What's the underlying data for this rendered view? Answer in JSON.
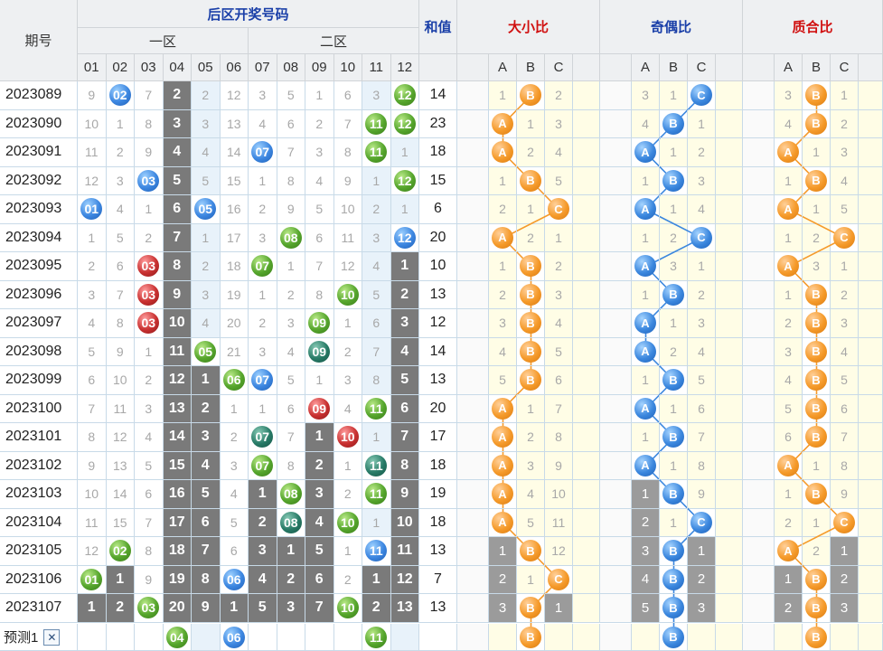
{
  "header": {
    "period_label": "期号",
    "back_zone_title": "后区开奖号码",
    "zone1_label": "一区",
    "zone2_label": "二区",
    "sum_label": "和值",
    "ratio_titles": [
      "大小比",
      "奇偶比",
      "质合比"
    ],
    "numbers": [
      "01",
      "02",
      "03",
      "04",
      "05",
      "06",
      "07",
      "08",
      "09",
      "10",
      "11",
      "12"
    ],
    "abc": [
      "A",
      "B",
      "C"
    ]
  },
  "rows": [
    {
      "period": "2023089",
      "cells": [
        "9",
        {
          "b": "02",
          "c": "blue"
        },
        "7",
        {
          "d": "2"
        },
        "2",
        "12",
        "3",
        "5",
        "1",
        "6",
        "3",
        {
          "b": "12",
          "c": "green"
        }
      ],
      "sum": "14",
      "r1": [
        "1",
        {
          "o": "B"
        },
        "2"
      ],
      "r2": [
        "3",
        "1",
        {
          "u": "C"
        }
      ],
      "r3": [
        "3",
        {
          "o": "B"
        },
        "1"
      ]
    },
    {
      "period": "2023090",
      "cells": [
        "10",
        "1",
        "8",
        {
          "d": "3"
        },
        "3",
        "13",
        "4",
        "6",
        "2",
        "7",
        {
          "b": "11",
          "c": "green"
        },
        {
          "b": "12",
          "c": "green"
        }
      ],
      "sum": "23",
      "r1": [
        {
          "o": "A"
        },
        "1",
        "3"
      ],
      "r2": [
        "4",
        {
          "u": "B"
        },
        "1"
      ],
      "r3": [
        "4",
        {
          "o": "B"
        },
        "2"
      ]
    },
    {
      "period": "2023091",
      "cells": [
        "11",
        "2",
        "9",
        {
          "d": "4"
        },
        "4",
        "14",
        {
          "b": "07",
          "c": "blue"
        },
        "7",
        "3",
        "8",
        {
          "b": "11",
          "c": "green"
        },
        "1"
      ],
      "sum": "18",
      "r1": [
        {
          "o": "A"
        },
        "2",
        "4"
      ],
      "r2": [
        {
          "u": "A"
        },
        "1",
        "2"
      ],
      "r3": [
        {
          "o": "A"
        },
        "1",
        "3"
      ]
    },
    {
      "period": "2023092",
      "cells": [
        "12",
        "3",
        {
          "b": "03",
          "c": "blue"
        },
        {
          "d": "5"
        },
        "5",
        "15",
        "1",
        "8",
        "4",
        "9",
        "1",
        {
          "b": "12",
          "c": "green"
        }
      ],
      "sum": "15",
      "r1": [
        "1",
        {
          "o": "B"
        },
        "5"
      ],
      "r2": [
        "1",
        {
          "u": "B"
        },
        "3"
      ],
      "r3": [
        "1",
        {
          "o": "B"
        },
        "4"
      ]
    },
    {
      "period": "2023093",
      "cells": [
        {
          "b": "01",
          "c": "blue"
        },
        "4",
        "1",
        {
          "d": "6"
        },
        {
          "b": "05",
          "c": "blue"
        },
        "16",
        "2",
        "9",
        "5",
        "10",
        "2",
        "1"
      ],
      "sum": "6",
      "r1": [
        "2",
        "1",
        {
          "o": "C"
        }
      ],
      "r2": [
        {
          "u": "A"
        },
        "1",
        "4"
      ],
      "r3": [
        {
          "o": "A"
        },
        "1",
        "5"
      ]
    },
    {
      "period": "2023094",
      "cells": [
        "1",
        "5",
        "2",
        {
          "d": "7"
        },
        "1",
        "17",
        "3",
        {
          "b": "08",
          "c": "green"
        },
        "6",
        "11",
        "3",
        {
          "b": "12",
          "c": "blue"
        }
      ],
      "sum": "20",
      "r1": [
        {
          "o": "A"
        },
        "2",
        "1"
      ],
      "r2": [
        "1",
        "2",
        {
          "u": "C"
        }
      ],
      "r3": [
        "1",
        "2",
        {
          "o": "C"
        }
      ]
    },
    {
      "period": "2023095",
      "cells": [
        "2",
        "6",
        {
          "b": "03",
          "c": "red"
        },
        {
          "d": "8"
        },
        "2",
        "18",
        {
          "b": "07",
          "c": "green"
        },
        "1",
        "7",
        "12",
        "4",
        {
          "d": "1"
        }
      ],
      "sum": "10",
      "r1": [
        "1",
        {
          "o": "B"
        },
        "2"
      ],
      "r2": [
        {
          "u": "A"
        },
        "3",
        "1"
      ],
      "r3": [
        {
          "o": "A"
        },
        "3",
        "1"
      ]
    },
    {
      "period": "2023096",
      "cells": [
        "3",
        "7",
        {
          "b": "03",
          "c": "red"
        },
        {
          "d": "9"
        },
        "3",
        "19",
        "1",
        "2",
        "8",
        {
          "b": "10",
          "c": "green"
        },
        "5",
        {
          "d": "2"
        }
      ],
      "sum": "13",
      "r1": [
        "2",
        {
          "o": "B"
        },
        "3"
      ],
      "r2": [
        "1",
        {
          "u": "B"
        },
        "2"
      ],
      "r3": [
        "1",
        {
          "o": "B"
        },
        "2"
      ]
    },
    {
      "period": "2023097",
      "cells": [
        "4",
        "8",
        {
          "b": "03",
          "c": "red"
        },
        {
          "d": "10"
        },
        "4",
        "20",
        "2",
        "3",
        {
          "b": "09",
          "c": "green"
        },
        "1",
        "6",
        {
          "d": "3"
        }
      ],
      "sum": "12",
      "r1": [
        "3",
        {
          "o": "B"
        },
        "4"
      ],
      "r2": [
        {
          "u": "A"
        },
        "1",
        "3"
      ],
      "r3": [
        "2",
        {
          "o": "B"
        },
        "3"
      ]
    },
    {
      "period": "2023098",
      "cells": [
        "5",
        "9",
        "1",
        {
          "d": "11"
        },
        {
          "b": "05",
          "c": "green"
        },
        "21",
        "3",
        "4",
        {
          "b": "09",
          "c": "teal"
        },
        "2",
        "7",
        {
          "d": "4"
        }
      ],
      "sum": "14",
      "r1": [
        "4",
        {
          "o": "B"
        },
        "5"
      ],
      "r2": [
        {
          "u": "A"
        },
        "2",
        "4"
      ],
      "r3": [
        "3",
        {
          "o": "B"
        },
        "4"
      ]
    },
    {
      "period": "2023099",
      "cells": [
        "6",
        "10",
        "2",
        {
          "d": "12"
        },
        {
          "d": "1"
        },
        {
          "b": "06",
          "c": "green"
        },
        {
          "b": "07",
          "c": "blue"
        },
        "5",
        "1",
        "3",
        "8",
        {
          "d": "5"
        }
      ],
      "sum": "13",
      "r1": [
        "5",
        {
          "o": "B"
        },
        "6"
      ],
      "r2": [
        "1",
        {
          "u": "B"
        },
        "5"
      ],
      "r3": [
        "4",
        {
          "o": "B"
        },
        "5"
      ]
    },
    {
      "period": "2023100",
      "cells": [
        "7",
        "11",
        "3",
        {
          "d": "13"
        },
        {
          "d": "2"
        },
        "1",
        "1",
        "6",
        {
          "b": "09",
          "c": "red"
        },
        "4",
        {
          "b": "11",
          "c": "green"
        },
        {
          "d": "6"
        }
      ],
      "sum": "20",
      "r1": [
        {
          "o": "A"
        },
        "1",
        "7"
      ],
      "r2": [
        {
          "u": "A"
        },
        "1",
        "6"
      ],
      "r3": [
        "5",
        {
          "o": "B"
        },
        "6"
      ]
    },
    {
      "period": "2023101",
      "cells": [
        "8",
        "12",
        "4",
        {
          "d": "14"
        },
        {
          "d": "3"
        },
        "2",
        {
          "b": "07",
          "c": "teal"
        },
        "7",
        {
          "d": "1"
        },
        {
          "b": "10",
          "c": "red"
        },
        "1",
        {
          "d": "7"
        }
      ],
      "sum": "17",
      "r1": [
        {
          "o": "A"
        },
        "2",
        "8"
      ],
      "r2": [
        "1",
        {
          "u": "B"
        },
        "7"
      ],
      "r3": [
        "6",
        {
          "o": "B"
        },
        "7"
      ]
    },
    {
      "period": "2023102",
      "cells": [
        "9",
        "13",
        "5",
        {
          "d": "15"
        },
        {
          "d": "4"
        },
        "3",
        {
          "b": "07",
          "c": "green"
        },
        "8",
        {
          "d": "2"
        },
        "1",
        {
          "b": "11",
          "c": "teal"
        },
        {
          "d": "8"
        }
      ],
      "sum": "18",
      "r1": [
        {
          "o": "A"
        },
        "3",
        "9"
      ],
      "r2": [
        {
          "u": "A"
        },
        "1",
        "8"
      ],
      "r3": [
        {
          "o": "A"
        },
        "1",
        "8"
      ]
    },
    {
      "period": "2023103",
      "cells": [
        "10",
        "14",
        "6",
        {
          "d": "16"
        },
        {
          "d": "5"
        },
        "4",
        {
          "d": "1"
        },
        {
          "b": "08",
          "c": "green"
        },
        {
          "d": "3"
        },
        "2",
        {
          "b": "11",
          "c": "green"
        },
        {
          "d": "9"
        }
      ],
      "sum": "19",
      "r1": [
        {
          "o": "A"
        },
        "4",
        "10"
      ],
      "r2": [
        {
          "d": "1"
        },
        {
          "u": "B"
        },
        "9"
      ],
      "r3": [
        "1",
        {
          "o": "B"
        },
        "9"
      ]
    },
    {
      "period": "2023104",
      "cells": [
        "11",
        "15",
        "7",
        {
          "d": "17"
        },
        {
          "d": "6"
        },
        "5",
        {
          "d": "2"
        },
        {
          "b": "08",
          "c": "teal"
        },
        {
          "d": "4"
        },
        {
          "b": "10",
          "c": "green"
        },
        "1",
        {
          "d": "10"
        }
      ],
      "sum": "18",
      "r1": [
        {
          "o": "A"
        },
        "5",
        "11"
      ],
      "r2": [
        {
          "d": "2"
        },
        "1",
        {
          "u": "C"
        }
      ],
      "r3": [
        "2",
        "1",
        {
          "o": "C"
        }
      ]
    },
    {
      "period": "2023105",
      "cells": [
        "12",
        {
          "b": "02",
          "c": "green"
        },
        "8",
        {
          "d": "18"
        },
        {
          "d": "7"
        },
        "6",
        {
          "d": "3"
        },
        {
          "d": "1"
        },
        {
          "d": "5"
        },
        "1",
        {
          "b": "11",
          "c": "blue"
        },
        {
          "d": "11"
        }
      ],
      "sum": "13",
      "r1": [
        {
          "d": "1"
        },
        {
          "o": "B"
        },
        "12"
      ],
      "r2": [
        {
          "d": "3"
        },
        {
          "u": "B"
        },
        {
          "d": "1"
        }
      ],
      "r3": [
        {
          "o": "A"
        },
        "2",
        {
          "d": "1"
        }
      ]
    },
    {
      "period": "2023106",
      "cells": [
        {
          "b": "01",
          "c": "green"
        },
        {
          "d": "1"
        },
        "9",
        {
          "d": "19"
        },
        {
          "d": "8"
        },
        {
          "b": "06",
          "c": "blue"
        },
        {
          "d": "4"
        },
        {
          "d": "2"
        },
        {
          "d": "6"
        },
        "2",
        {
          "d": "1"
        },
        {
          "d": "12"
        }
      ],
      "sum": "7",
      "r1": [
        {
          "d": "2"
        },
        "1",
        {
          "o": "C"
        }
      ],
      "r2": [
        {
          "d": "4"
        },
        {
          "u": "B"
        },
        {
          "d": "2"
        }
      ],
      "r3": [
        {
          "d": "1"
        },
        {
          "o": "B"
        },
        {
          "d": "2"
        }
      ]
    },
    {
      "period": "2023107",
      "cells": [
        {
          "d": "1"
        },
        {
          "d": "2"
        },
        {
          "b": "03",
          "c": "green"
        },
        {
          "d": "20"
        },
        {
          "d": "9"
        },
        {
          "d": "1"
        },
        {
          "d": "5"
        },
        {
          "d": "3"
        },
        {
          "d": "7"
        },
        {
          "b": "10",
          "c": "green"
        },
        {
          "d": "2"
        },
        {
          "d": "13"
        }
      ],
      "sum": "13",
      "r1": [
        {
          "d": "3"
        },
        {
          "o": "B"
        },
        {
          "d": "1"
        }
      ],
      "r2": [
        {
          "d": "5"
        },
        {
          "u": "B"
        },
        {
          "d": "3"
        }
      ],
      "r3": [
        {
          "d": "2"
        },
        {
          "o": "B"
        },
        {
          "d": "3"
        }
      ]
    }
  ],
  "predict": {
    "label": "预测1",
    "close_symbol": "✕",
    "cells": [
      "",
      "",
      "",
      {
        "b": "04",
        "c": "green"
      },
      "",
      {
        "b": "06",
        "c": "blue"
      },
      "",
      "",
      "",
      "",
      {
        "b": "11",
        "c": "green"
      },
      ""
    ],
    "r1": [
      "",
      {
        "o": "B"
      },
      ""
    ],
    "r2": [
      "",
      {
        "u": "B"
      },
      ""
    ],
    "r3": [
      "",
      {
        "o": "B"
      },
      ""
    ]
  },
  "colors": {
    "header_blue": "#1a3fa8",
    "header_red": "#d01010",
    "ratio_line_orange": "#f59a2a",
    "ratio_line_blue": "#3b87de"
  }
}
